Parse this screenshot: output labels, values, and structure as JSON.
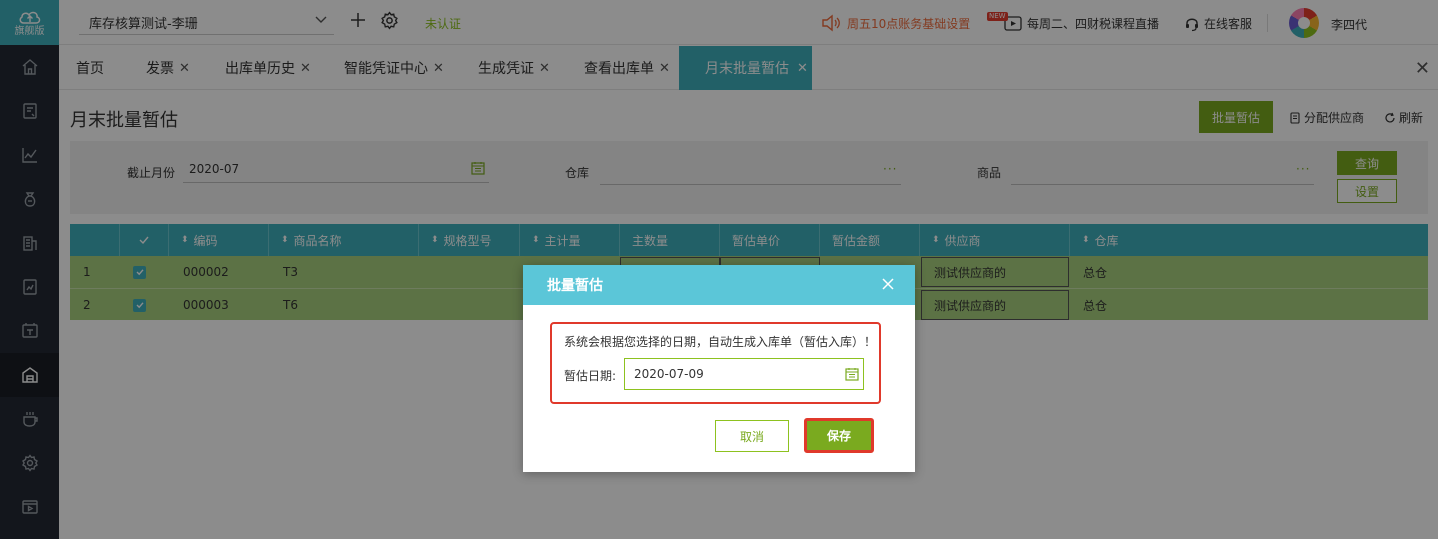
{
  "colors": {
    "brand": "#3fb0bc",
    "accent_green": "#7aaa1f",
    "row_selected": "#a8d07e",
    "highlight_red": "#e0392b"
  },
  "sidebar": {
    "logo_text": "旗舰版",
    "items": [
      {
        "icon": "home-icon"
      },
      {
        "icon": "invoice-icon"
      },
      {
        "icon": "chart-icon"
      },
      {
        "icon": "money-bag-icon"
      },
      {
        "icon": "building-icon"
      },
      {
        "icon": "report-icon"
      },
      {
        "icon": "tax-icon"
      },
      {
        "icon": "warehouse-icon"
      },
      {
        "icon": "cup-icon"
      },
      {
        "icon": "settings-icon"
      },
      {
        "icon": "video-icon"
      }
    ]
  },
  "topbar": {
    "company": "库存核算测试-李珊",
    "unverified": "未认证",
    "promo": "周五10点账务基础设置",
    "live_badge": "NEW",
    "live": "每周二、四财税课程直播",
    "service": "在线客服",
    "username": "李四代"
  },
  "tabs": [
    {
      "label": "首页",
      "closable": false
    },
    {
      "label": "发票",
      "closable": true
    },
    {
      "label": "出库单历史",
      "closable": true
    },
    {
      "label": "智能凭证中心",
      "closable": true
    },
    {
      "label": "生成凭证",
      "closable": true
    },
    {
      "label": "查看出库单",
      "closable": true
    },
    {
      "label": "月末批量暂估",
      "closable": true,
      "active": true
    }
  ],
  "page": {
    "title": "月末批量暂估",
    "batch_button": "批量暂估",
    "assign_supplier": "分配供应商",
    "refresh": "刷新"
  },
  "filter": {
    "cutoff_label": "截止月份",
    "cutoff_value": "2020-07",
    "warehouse_label": "仓库",
    "goods_label": "商品",
    "query_button": "查询",
    "setting_button": "设置",
    "dots": "···"
  },
  "table": {
    "headers": {
      "code": "编码",
      "name": "商品名称",
      "spec": "规格型号",
      "unit": "主计量",
      "qty": "主数量",
      "price": "暂估单价",
      "amount": "暂估金额",
      "supplier": "供应商",
      "warehouse": "仓库"
    },
    "rows": [
      {
        "idx": "1",
        "checked": true,
        "code": "000002",
        "name": "T3",
        "supplier": "测试供应商的",
        "warehouse": "总仓"
      },
      {
        "idx": "2",
        "checked": true,
        "code": "000003",
        "name": "T6",
        "supplier": "测试供应商的",
        "warehouse": "总仓"
      }
    ]
  },
  "modal": {
    "title": "批量暂估",
    "notice": "系统会根据您选择的日期，自动生成入库单（暂估入库）！",
    "date_label": "暂估日期:",
    "date_value": "2020-07-09",
    "cancel": "取消",
    "save": "保存"
  }
}
